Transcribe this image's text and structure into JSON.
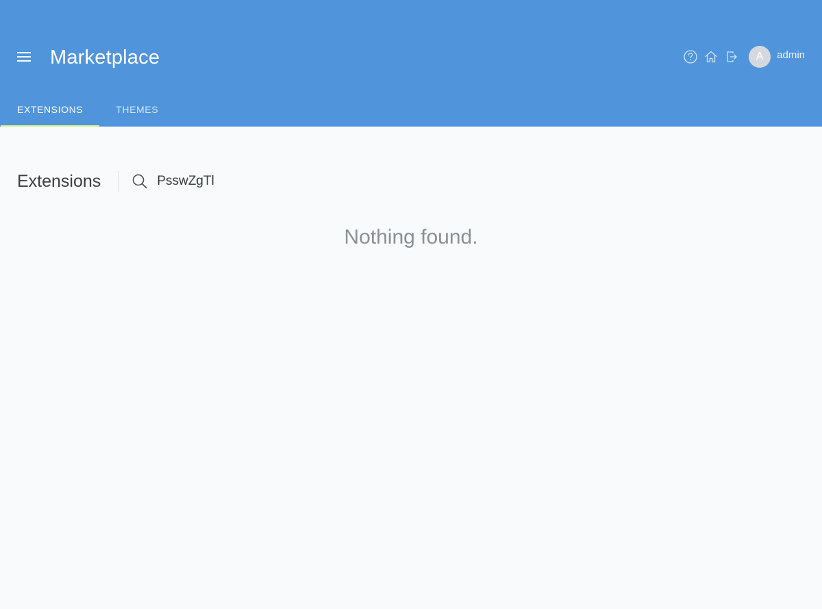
{
  "header": {
    "title": "Marketplace",
    "menu_icon": "menu-icon",
    "actions": {
      "help_icon": "help-icon",
      "home_icon": "home-icon",
      "logout_icon": "logout-icon"
    },
    "user": {
      "avatar_letter": "A",
      "name": "admin"
    }
  },
  "tabs": [
    {
      "label": "EXTENSIONS",
      "active": true
    },
    {
      "label": "THEMES",
      "active": false
    }
  ],
  "main": {
    "section_title": "Extensions",
    "search": {
      "value": "PsswZgTl",
      "icon": "search-icon"
    },
    "empty_message": "Nothing found."
  },
  "colors": {
    "header_bg": "#5095db",
    "active_tab_indicator": "#d4f08a",
    "page_bg": "#f9fafb"
  }
}
